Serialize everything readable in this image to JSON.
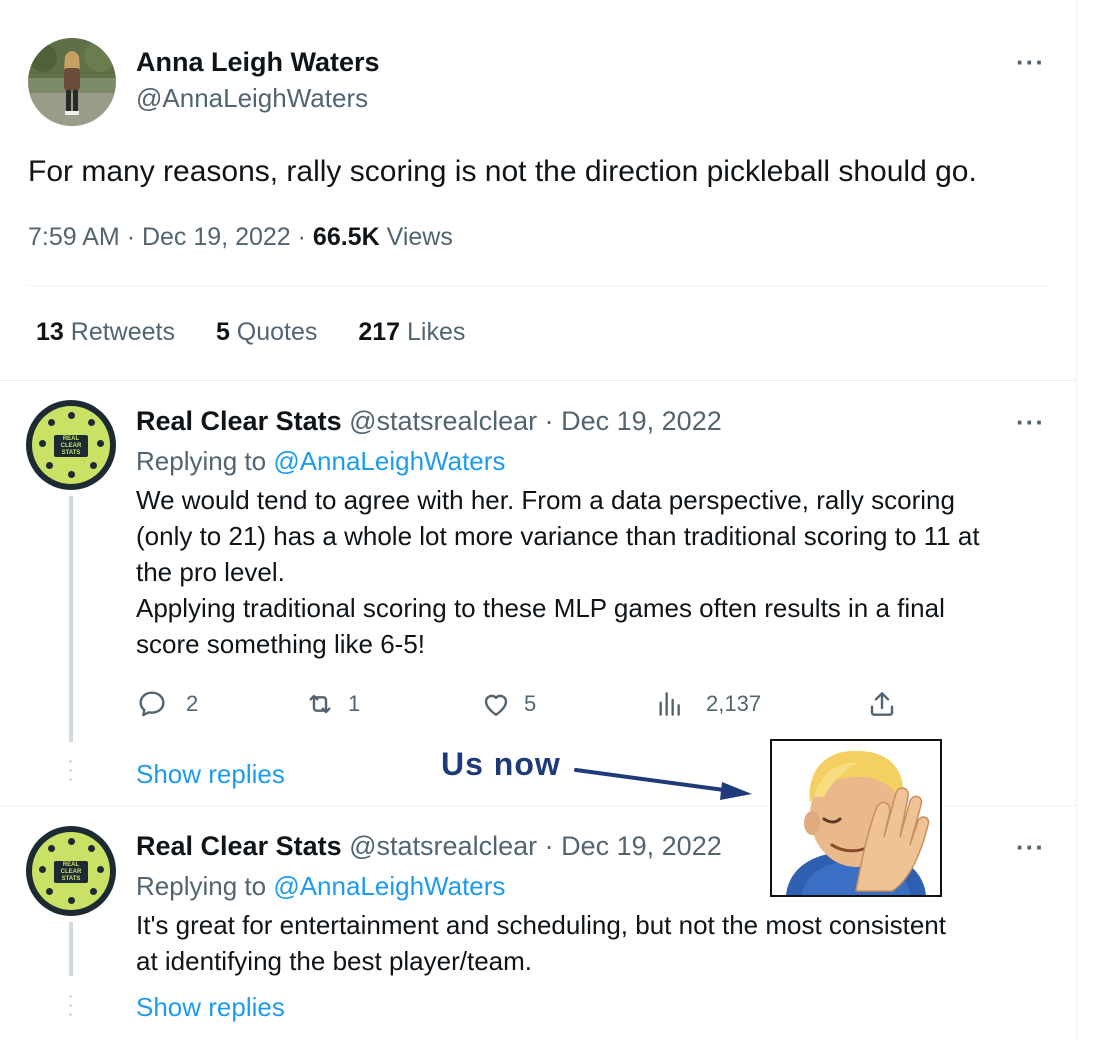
{
  "tweet": {
    "author_name": "Anna Leigh Waters",
    "author_handle": "@AnnaLeighWaters",
    "text": "For many reasons, rally scoring is not the direction pickleball should go.",
    "time": "7:59 AM",
    "date": "Dec 19, 2022",
    "views_count": "66.5K",
    "views_label": "Views",
    "separator": "·",
    "more_label": "···"
  },
  "stats": {
    "retweets_count": "13",
    "retweets_label": "Retweets",
    "quotes_count": "5",
    "quotes_label": "Quotes",
    "likes_count": "217",
    "likes_label": "Likes"
  },
  "replies": [
    {
      "name": "Real Clear Stats",
      "handle": "@statsrealclear",
      "date_text": "· Dec 19, 2022",
      "replying_prefix": "Replying to",
      "replying_to": "@AnnaLeighWaters",
      "body_lines": [
        "We would tend to agree with her. From a data perspective, rally scoring",
        "(only to 21) has a whole lot more variance than traditional scoring to 11 at",
        "the pro level.",
        "Applying traditional scoring to these MLP games often results in a final",
        "score something like 6-5!"
      ],
      "reply_count": "2",
      "retweet_count": "1",
      "like_count": "5",
      "view_count": "2,137",
      "show_replies": "Show replies"
    },
    {
      "name": "Real Clear Stats",
      "handle": "@statsrealclear",
      "date_text": "· Dec 19, 2022",
      "replying_prefix": "Replying to",
      "replying_to": "@AnnaLeighWaters",
      "body_lines": [
        "It's great for entertainment and scheduling, but not the most consistent",
        "at identifying the best player/team."
      ],
      "show_replies": "Show replies"
    }
  ],
  "avatar_logo": {
    "line1": "REAL",
    "line2": "CLEAR",
    "line3": "STATS",
    "line4": "@StatsRealClear"
  },
  "annotation": {
    "text": "Us now",
    "color": "#1e3a78",
    "emoji": "facepalm-man"
  },
  "colors": {
    "link": "#1d9bf0",
    "muted": "#536471",
    "logo_green": "#c9e265",
    "logo_dark": "#1d2a33"
  }
}
